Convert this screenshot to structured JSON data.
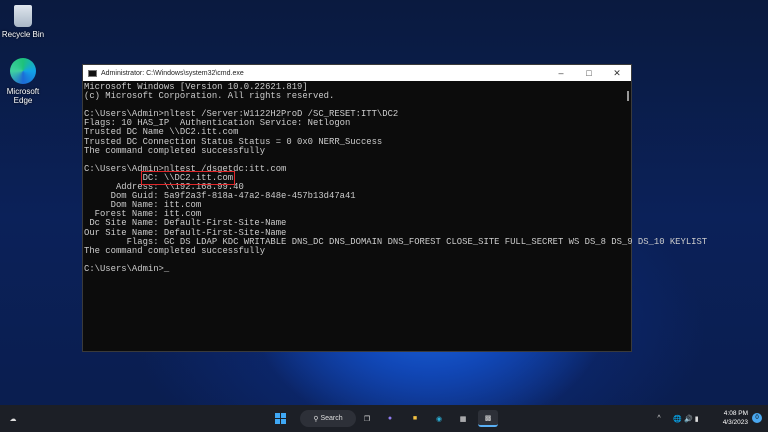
{
  "desktop": {
    "icons": [
      {
        "label": "Recycle Bin"
      },
      {
        "label": "Microsoft Edge"
      }
    ]
  },
  "window": {
    "title": "Administrator: C:\\Windows\\system32\\cmd.exe",
    "lines": [
      "Microsoft Windows [Version 10.0.22621.819]",
      "(c) Microsoft Corporation. All rights reserved.",
      "",
      "C:\\Users\\Admin>nltest /Server:W1122H2ProD /SC_RESET:ITT\\DC2",
      "Flags: 10 HAS_IP  Authentication Service: Netlogon",
      "Trusted DC Name \\\\DC2.itt.com",
      "Trusted DC Connection Status Status = 0 0x0 NERR_Success",
      "The command completed successfully",
      "",
      "C:\\Users\\Admin>nltest /dsgetdc:itt.com"
    ],
    "dc_prefix": "           ",
    "dc_line": "DC: \\\\DC2.itt.com",
    "lines2": [
      "      Address: \\\\192.168.99.40",
      "     Dom Guid: 5a9f2a3f-818a-47a2-848e-457b13d47a41",
      "     Dom Name: itt.com",
      "  Forest Name: itt.com",
      " Dc Site Name: Default-First-Site-Name",
      "Our Site Name: Default-First-Site-Name",
      "        Flags: GC DS LDAP KDC WRITABLE DNS_DC DNS_DOMAIN DNS_FOREST CLOSE_SITE FULL_SECRET WS DS_8 DS_9 DS_10 KEYLIST",
      "The command completed successfully",
      "",
      "C:\\Users\\Admin>_"
    ]
  },
  "taskbar": {
    "search_label": "Search",
    "time": "4:08 PM",
    "date": "4/3/2023",
    "notifications": "0"
  }
}
